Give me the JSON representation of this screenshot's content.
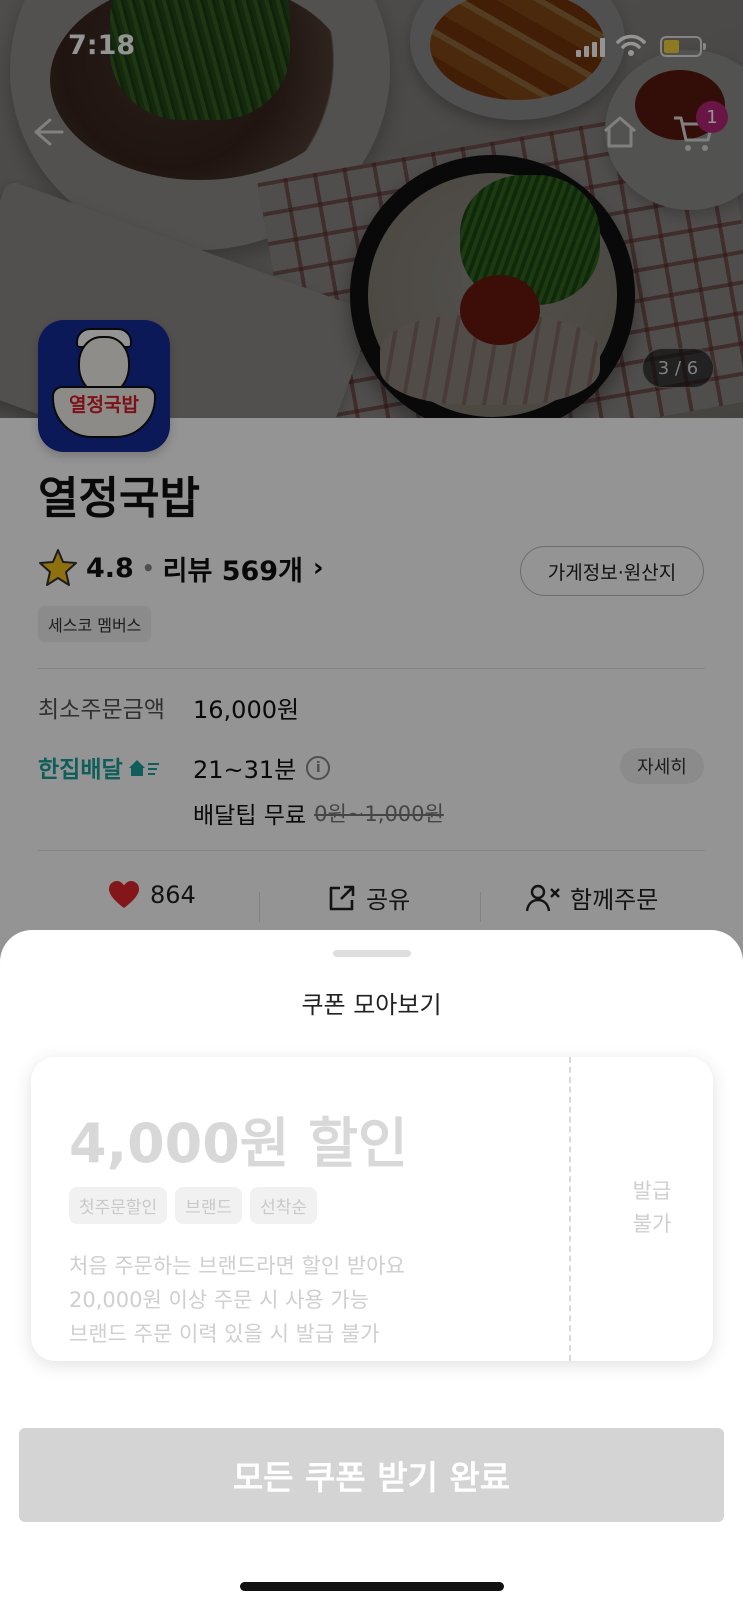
{
  "status_bar": {
    "time": "7:18"
  },
  "hero": {
    "image_counter": "3 / 6",
    "cart_count": "1"
  },
  "store": {
    "name": "열정국밥",
    "logo_text": "열정국밥",
    "rating": "4.8",
    "reviews_label": "리뷰 569개",
    "info_button": "가게정보·원산지",
    "member_tag": "세스코 멤버스",
    "min_order_label": "최소주문금액",
    "min_order_value": "16,000원",
    "delivery_brand": "한집배달",
    "delivery_time": "21~31분",
    "detail_button": "자세히",
    "tip_label": "배달팁 무료",
    "tip_original": "0원~1,000원",
    "actions": {
      "likes": "864",
      "share": "공유",
      "group_order": "함께주문"
    }
  },
  "sheet": {
    "title": "쿠폰 모아보기",
    "coupon": {
      "amount": "4,000원 할인",
      "tags": [
        "첫주문할인",
        "브랜드",
        "선착순"
      ],
      "desc": [
        "처음 주문하는 브랜드라면 할인 받아요",
        "20,000원 이상 주문 시 사용 가능",
        "브랜드 주문 이력 있을 시 발급 불가"
      ],
      "status": [
        "발급",
        "불가"
      ]
    },
    "claim_button": "모든 쿠폰 받기 완료"
  },
  "colors": {
    "delivery_brand": "#1aa39b",
    "cart_badge": "#b5277a",
    "heart": "#e0262b"
  }
}
